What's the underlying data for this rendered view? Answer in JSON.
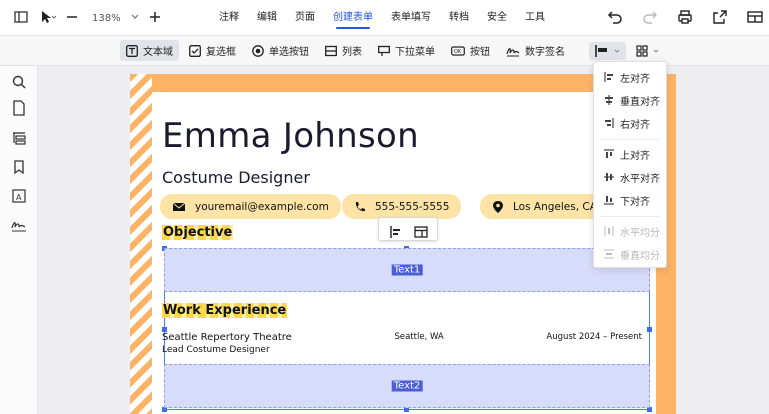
{
  "topbar": {
    "zoom": "138%",
    "menu": [
      "注释",
      "编辑",
      "页面",
      "创建表单",
      "表单填写",
      "转档",
      "安全",
      "工具"
    ],
    "active_menu": "创建表单"
  },
  "form_tools": {
    "items": [
      "文本域",
      "复选框",
      "单选按钮",
      "列表",
      "下拉菜单",
      "按钮",
      "数字签名"
    ]
  },
  "align_menu": {
    "items": [
      {
        "label": "左对齐",
        "disabled": false
      },
      {
        "label": "垂直对齐",
        "disabled": false
      },
      {
        "label": "右对齐",
        "disabled": false
      },
      {
        "label": "上对齐",
        "disabled": false
      },
      {
        "label": "水平对齐",
        "disabled": false
      },
      {
        "label": "下对齐",
        "disabled": false
      },
      {
        "label": "水平均分",
        "disabled": true
      },
      {
        "label": "垂直均分",
        "disabled": true
      }
    ]
  },
  "resume": {
    "name": "Emma Johnson",
    "role": "Costume Designer",
    "email": "youremail@example.com",
    "phone": "555-555-5555",
    "location": "Los Angeles, CA",
    "objective_title": "Objective",
    "experience_title": "Work Experience",
    "job_company": "Seattle Repertory Theatre",
    "job_location": "Seattle, WA",
    "job_dates": "August 2024 – Present",
    "job_title": "Lead Costume Designer"
  },
  "fields": {
    "field1": "Text1",
    "field2": "Text2"
  },
  "colors": {
    "accent": "#2456d9",
    "orange": "#fdb366",
    "pill": "#fde4a6",
    "field": "#d8dcfb"
  }
}
